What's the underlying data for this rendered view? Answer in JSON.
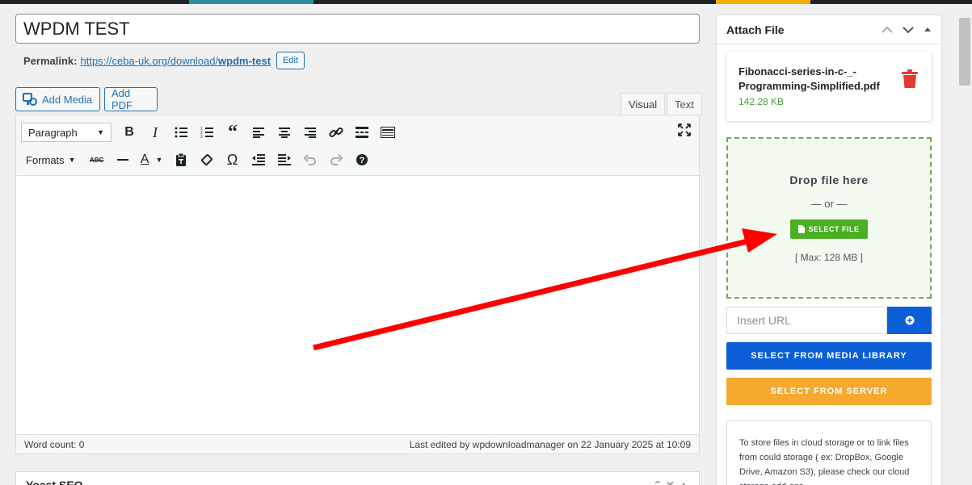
{
  "colors": {
    "accent": "#2271b1",
    "green": "#4caf24",
    "blue": "#0c5ed7",
    "orange": "#f5a92e",
    "arrow": "#ff0000",
    "trash": "#e53935"
  },
  "post": {
    "title": "WPDM TEST"
  },
  "permalink": {
    "label": "Permalink:",
    "base": "https://ceba-uk.org/download/",
    "slug": "wpdm-test",
    "edit_label": "Edit"
  },
  "media": {
    "add_media": "Add Media",
    "add_pdf": "Add PDF"
  },
  "tabs": {
    "visual": "Visual",
    "text": "Text"
  },
  "toolbar": {
    "paragraph": "Paragraph",
    "formats": "Formats"
  },
  "status": {
    "word_count": "Word count: 0",
    "last_edited": "Last edited by wpdownloadmanager on 22 January 2025 at 10:09"
  },
  "yoast": {
    "title": "Yoast SEO"
  },
  "attach": {
    "title": "Attach File",
    "file": {
      "name": "Fibonacci-series-in-c-_-Programming-Simplified.pdf",
      "size": "142.28 KB"
    },
    "drop_title": "Drop file here",
    "or": "— or —",
    "select_file": "SELECT FILE",
    "max": "[ Max: 128 MB ]",
    "url_placeholder": "Insert URL",
    "media_library": "SELECT FROM MEDIA LIBRARY",
    "server": "SELECT FROM SERVER",
    "cloud_text": "To store files in cloud storage or to link files from could storage ( ex: DropBox, Google Drive, Amazon S3), please check our cloud storage add-ons"
  },
  "icons": [
    "media-icon",
    "bold-icon",
    "italic-icon",
    "bullet-list-icon",
    "numbered-list-icon",
    "blockquote-icon",
    "align-left-icon",
    "align-center-icon",
    "align-right-icon",
    "link-icon",
    "read-more-icon",
    "toolbar-toggle-icon",
    "fullscreen-icon",
    "strikethrough-icon",
    "horizontal-rule-icon",
    "text-color-icon",
    "paste-text-icon",
    "clear-formatting-icon",
    "special-character-icon",
    "outdent-icon",
    "indent-icon",
    "undo-icon",
    "redo-icon",
    "help-icon",
    "trash-icon",
    "file-icon",
    "plus-circle-icon",
    "chevron-up-icon",
    "chevron-down-icon",
    "collapse-icon"
  ]
}
